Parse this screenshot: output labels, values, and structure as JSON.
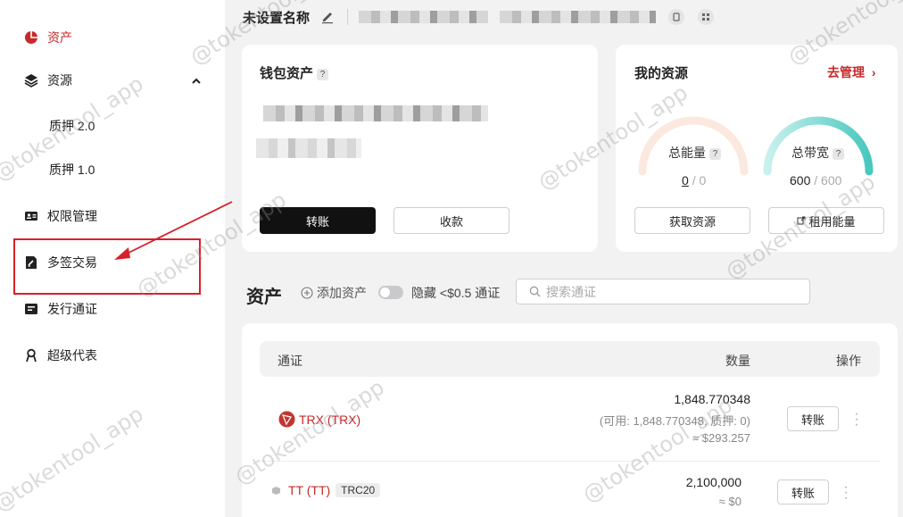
{
  "sidebar": {
    "items": [
      {
        "label": "资产",
        "icon": "pie-chart-icon"
      },
      {
        "label": "资源",
        "icon": "layers-icon"
      },
      {
        "label": "质押 2.0"
      },
      {
        "label": "质押 1.0"
      },
      {
        "label": "权限管理",
        "icon": "id-card-icon"
      },
      {
        "label": "多签交易",
        "icon": "sign-doc-icon"
      },
      {
        "label": "发行通证",
        "icon": "ticket-icon"
      },
      {
        "label": "超级代表",
        "icon": "user-badge-icon"
      }
    ]
  },
  "header": {
    "wallet_name": "未设置名称"
  },
  "wallet_card": {
    "title": "钱包资产",
    "transfer_label": "转账",
    "receive_label": "收款"
  },
  "resources_card": {
    "title": "我的资源",
    "manage_label": "去管理",
    "energy_label": "总能量",
    "energy_used": "0",
    "energy_total": "/ 0",
    "energy_fraction": 0,
    "bandwidth_label": "总带宽",
    "bandwidth_used": "600",
    "bandwidth_total": "/ 600",
    "bandwidth_fraction": 1,
    "get_resource_label": "获取资源",
    "rent_energy_label": "租用能量"
  },
  "assets": {
    "title": "资产",
    "add_label": "添加资产",
    "hide_label": "隐藏 <$0.5 通证",
    "search_placeholder": "搜索通证"
  },
  "table": {
    "headers": {
      "token": "通证",
      "amount": "数量",
      "action": "操作"
    },
    "rows": [
      {
        "name": "TRX (TRX)",
        "amount": "1,848.770348",
        "detail": "(可用: 1,848.770348, 质押: 0)",
        "value": "≈ $293.257",
        "action_label": "转账"
      },
      {
        "name": "TT (TT)",
        "tag": "TRC20",
        "amount": "2,100,000",
        "value": "≈ $0",
        "action_label": "转账"
      }
    ]
  },
  "watermark": "@tokentool_app",
  "colors": {
    "accent": "#c62a2a",
    "highlight_box": "#d8202a"
  }
}
